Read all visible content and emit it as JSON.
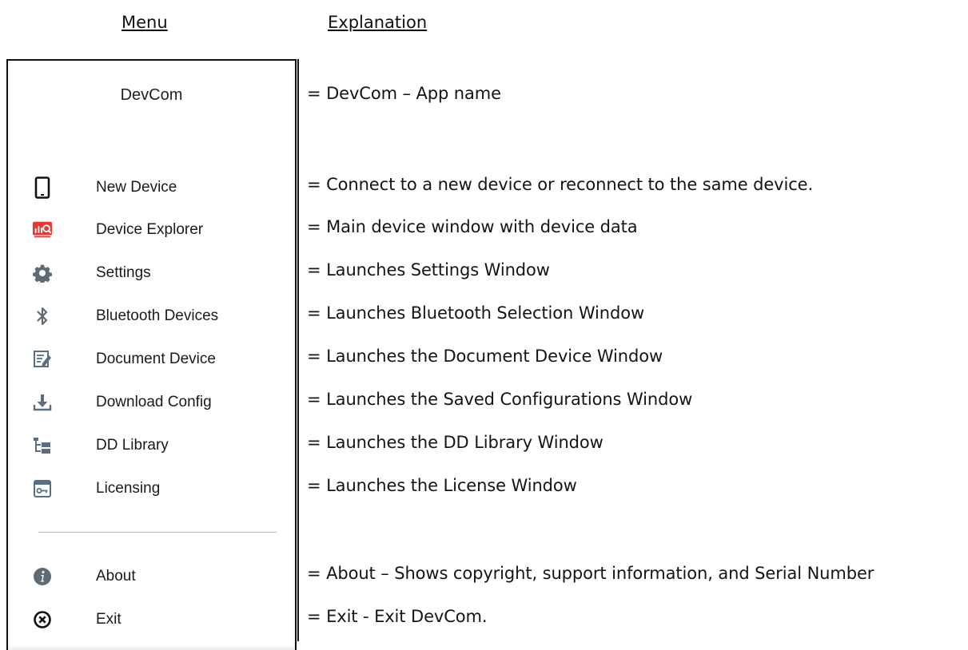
{
  "headers": {
    "menu": "Menu",
    "explanation": "Explanation"
  },
  "menu": {
    "app_title": "DevCom",
    "items": [
      {
        "label": "New Device",
        "icon": "tablet-icon"
      },
      {
        "label": "Device Explorer",
        "icon": "device-explorer-icon"
      },
      {
        "label": "Settings",
        "icon": "gear-icon"
      },
      {
        "label": "Bluetooth Devices",
        "icon": "bluetooth-icon"
      },
      {
        "label": "Document Device",
        "icon": "document-edit-icon"
      },
      {
        "label": "Download Config",
        "icon": "download-icon"
      },
      {
        "label": "DD Library",
        "icon": "library-tree-icon"
      },
      {
        "label": "Licensing",
        "icon": "license-key-icon"
      }
    ],
    "footer_items": [
      {
        "label": "About",
        "icon": "info-icon"
      },
      {
        "label": "Exit",
        "icon": "exit-icon"
      }
    ]
  },
  "explanations": {
    "app": "= DevCom – App name",
    "items": [
      "= Connect to a new device or reconnect to the same device.",
      "= Main device window with device data",
      "= Launches Settings Window",
      "= Launches Bluetooth Selection Window",
      "= Launches the Document Device Window",
      "= Launches the Saved Configurations Window",
      "= Launches the DD Library Window",
      "= Launches the License Window"
    ],
    "footer": [
      "= About – Shows copyright, support information, and Serial Number",
      "= Exit - Exit DevCom."
    ]
  },
  "colors": {
    "accent_red": "#e53935",
    "icon_gray": "#5f6b73",
    "icon_blue": "#5a6e80"
  }
}
